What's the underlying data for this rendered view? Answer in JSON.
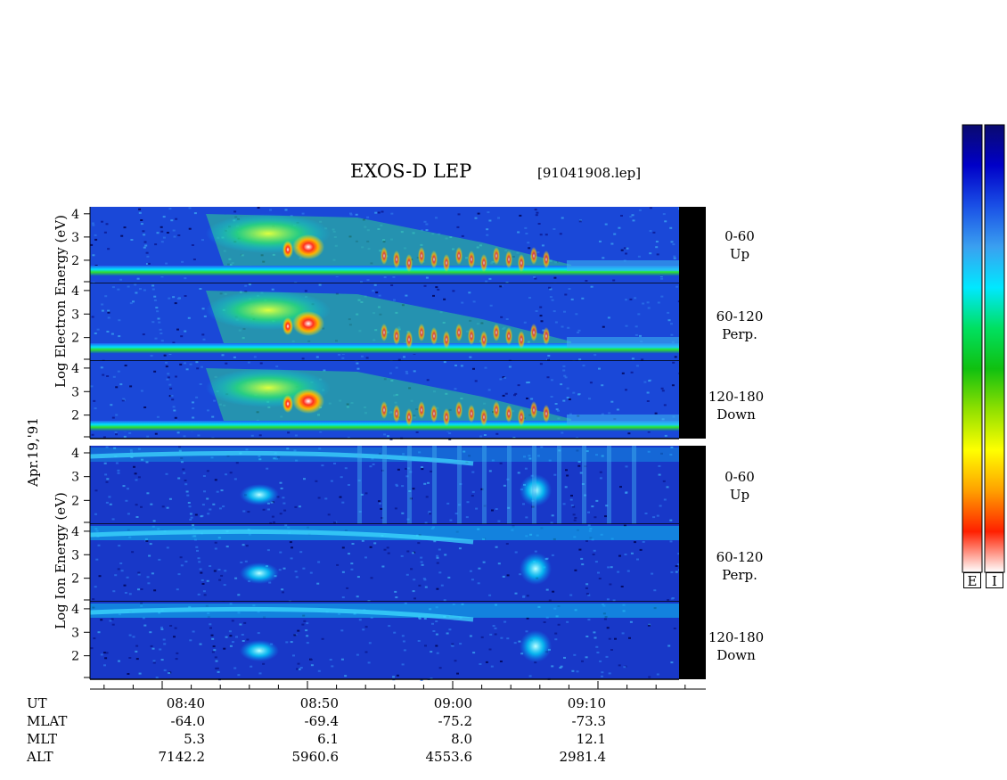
{
  "header": {
    "title": "EXOS-D LEP",
    "file": "[91041908.lep]"
  },
  "y_labels": {
    "electron": "Log Electron Energy (eV)",
    "ion": "Log Ion Energy (eV)",
    "date": "Apr.19,'91"
  },
  "channels": [
    {
      "range": "0-60",
      "dir": "Up"
    },
    {
      "range": "60-120",
      "dir": "Perp."
    },
    {
      "range": "120-180",
      "dir": "Down"
    },
    {
      "range": "0-60",
      "dir": "Up"
    },
    {
      "range": "60-120",
      "dir": "Perp."
    },
    {
      "range": "120-180",
      "dir": "Down"
    }
  ],
  "colorbar": {
    "labels": [
      "E",
      "I"
    ],
    "colors": [
      "#0a0a6e",
      "#0000c8",
      "#1a50e6",
      "#3aa0f0",
      "#00e8ff",
      "#00e060",
      "#10c010",
      "#90e000",
      "#ffff00",
      "#ffa000",
      "#ff2000",
      "#ffffff"
    ]
  },
  "aux_rows": [
    {
      "name": "UT",
      "values": [
        "08:40",
        "08:50",
        "09:00",
        "09:10"
      ]
    },
    {
      "name": "MLAT",
      "values": [
        "-64.0",
        "-69.4",
        "-75.2",
        "-73.3"
      ]
    },
    {
      "name": "MLT",
      "values": [
        "5.3",
        "6.1",
        "8.0",
        "12.1"
      ]
    },
    {
      "name": "ALT",
      "values": [
        "7142.2",
        "5960.6",
        "4553.6",
        "2981.4"
      ]
    }
  ],
  "chart_data": {
    "type": "heatmap",
    "title": "EXOS-D LEP",
    "xlabel": "UT",
    "x_ticks": [
      "08:40",
      "08:50",
      "09:00",
      "09:10"
    ],
    "ylabel_electron": "Log Electron Energy (eV)",
    "ylabel_ion": "Log Ion Energy (eV)",
    "y_ticks": [
      2,
      3,
      4
    ],
    "panels": [
      {
        "species": "electron",
        "pitch_angle": "0-60",
        "direction": "Up"
      },
      {
        "species": "electron",
        "pitch_angle": "60-120",
        "direction": "Perp."
      },
      {
        "species": "electron",
        "pitch_angle": "120-180",
        "direction": "Down"
      },
      {
        "species": "ion",
        "pitch_angle": "0-60",
        "direction": "Up"
      },
      {
        "species": "ion",
        "pitch_angle": "60-120",
        "direction": "Perp."
      },
      {
        "species": "ion",
        "pitch_angle": "120-180",
        "direction": "Down"
      }
    ]
  }
}
